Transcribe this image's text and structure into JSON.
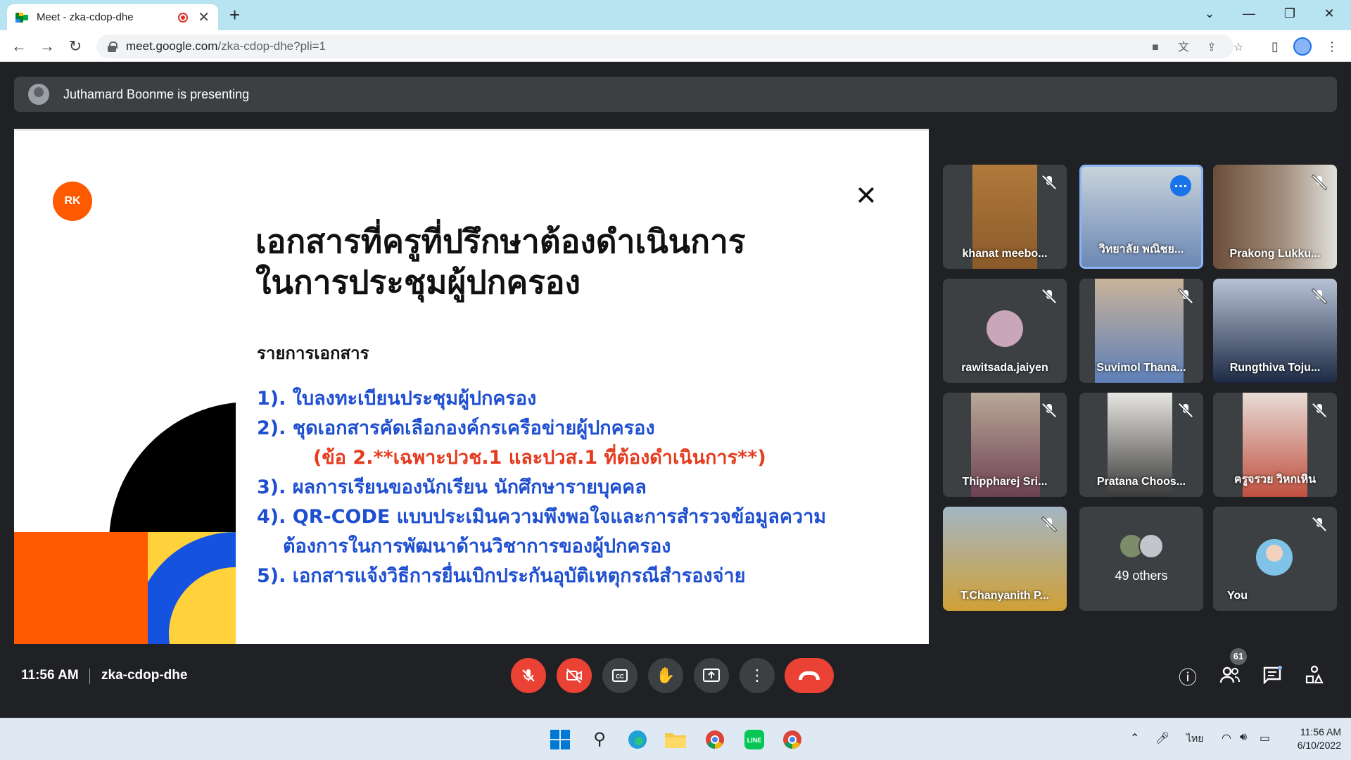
{
  "browser": {
    "tab_title": "Meet - zka-cdop-dhe",
    "tab_close": "✕",
    "new_tab": "+",
    "url_host": "meet.google.com",
    "url_path": "/zka-cdop-dhe?pli=1",
    "window_controls": [
      "⌄",
      "—",
      "❐",
      "✕"
    ]
  },
  "meet": {
    "presenting_text": "Juthamard Boonme is presenting",
    "slide": {
      "badge": "RK",
      "close": "✕",
      "title_line1": "เอกสารที่ครูที่ปรึกษาต้องดำเนินการ",
      "title_line2": "ในการประชุมผู้ปกครอง",
      "subtitle": "รายการเอกสาร",
      "items": [
        "1). ใบลงทะเบียนประชุมผู้ปกครอง",
        "2). ชุดเอกสารคัดเลือกองค์กรเครือข่ายผู้ปกครอง",
        "(ข้อ 2.**เฉพาะปวช.1 และปวส.1 ที่ต้องดำเนินการ**)",
        "3). ผลการเรียนของนักเรียน นักศึกษารายบุคคล",
        "4). QR-CODE แบบประเมินความพึงพอใจและการสำรวจข้อมูลความ",
        "ต้องการในการพัฒนาด้านวิชาการของผู้ปกครอง",
        "5). เอกสารแจ้งวิธีการยื่นเบิกประกันอุบัติเหตุกรณีสำรองจ่าย"
      ]
    },
    "participants": [
      {
        "name": "khanat meebo..."
      },
      {
        "name": "วิทยาลัย พณิชย..."
      },
      {
        "name": "Prakong Lukku..."
      },
      {
        "name": "rawitsada.jaiyen"
      },
      {
        "name": "Suvimol Thana..."
      },
      {
        "name": "Rungthiva Toju..."
      },
      {
        "name": "Thippharej Sri..."
      },
      {
        "name": "Pratana Choos..."
      },
      {
        "name": "ครูจรวย วิหกเหิน"
      },
      {
        "name": "T.Chanyanith P..."
      }
    ],
    "others_label": "49 others",
    "you_label": "You",
    "time": "11:56 AM",
    "meeting_code": "zka-cdop-dhe",
    "people_count": "61",
    "colors": {
      "end_call": "#ea4335",
      "slide_list": "#1f4fd1",
      "slide_note": "#e53b1f",
      "rk_badge": "#ff5a00"
    }
  },
  "taskbar": {
    "language": "ไทย",
    "clock_time": "11:56 AM",
    "clock_date": "6/10/2022"
  }
}
